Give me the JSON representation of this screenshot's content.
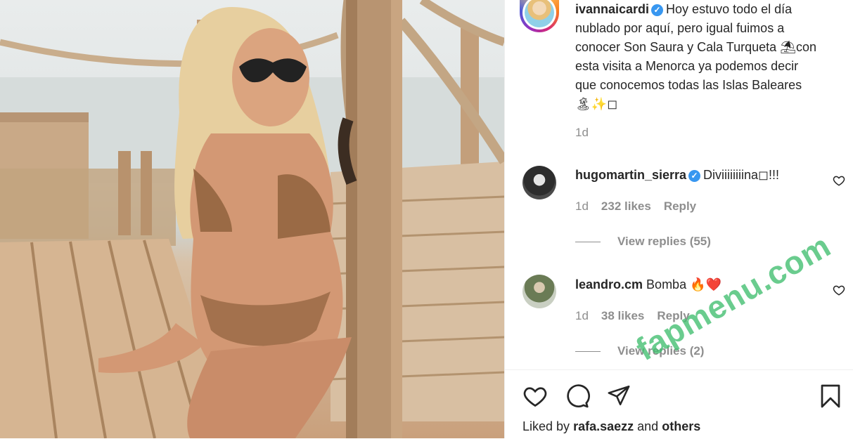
{
  "post": {
    "username": "ivannaicardi",
    "caption_lines": [
      "Hoy estuvo todo el día",
      "nublado por aquí, pero igual fuimos a",
      "conocer Son Saura y Cala Turqueta ⛱con",
      "esta visita a Menorca ya podemos decir",
      "que conocemos todas las Islas Baleares",
      "🏝✨◻"
    ],
    "time": "1d"
  },
  "comments": [
    {
      "username": "hugomartin_sierra",
      "verified": true,
      "text": "Diviiiiiiiina◻!!!",
      "time": "1d",
      "likes": "232 likes",
      "reply_label": "Reply",
      "view_replies": "View replies (55)"
    },
    {
      "username": "leandro.cm",
      "verified": false,
      "text": "Bomba 🔥❤️",
      "time": "1d",
      "likes": "38 likes",
      "reply_label": "Reply",
      "view_replies": "View replies (2)"
    }
  ],
  "liked_by": {
    "prefix": "Liked by",
    "user": "rafa.saezz",
    "and": "and",
    "others": "others"
  },
  "watermark": "fapmenu.com",
  "icons": [
    "verified-badge-icon",
    "heart-icon",
    "comment-icon",
    "share-icon",
    "bookmark-icon",
    "small-heart-icon"
  ],
  "colors": {
    "verified": "#3897f0",
    "muted": "#8e8e8e",
    "text": "#262626",
    "watermark": "#40be6e"
  }
}
